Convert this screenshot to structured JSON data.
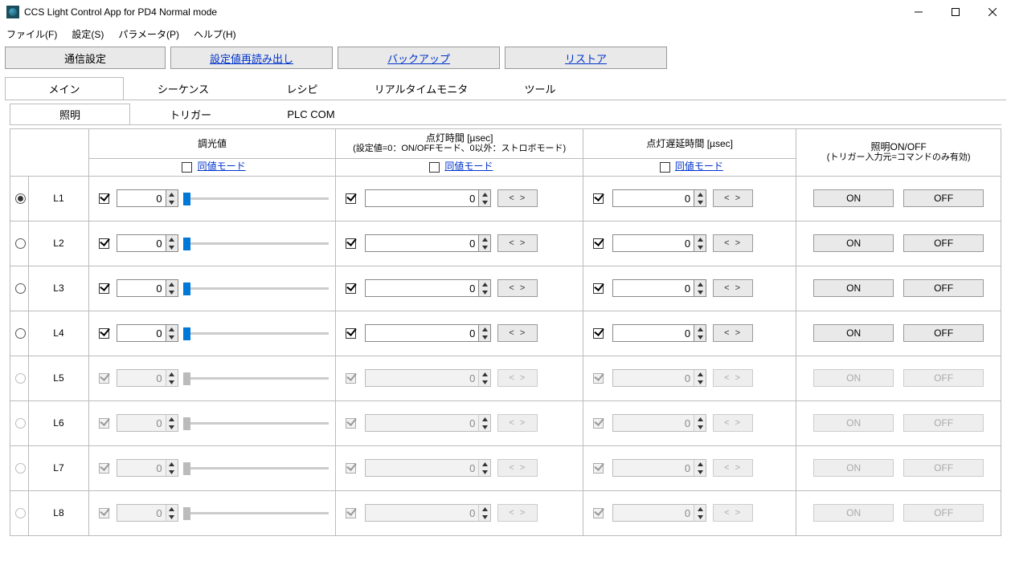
{
  "window": {
    "title": "CCS Light Control App for PD4 Normal mode"
  },
  "menu": {
    "file": "ファイル(F)",
    "settings": "設定(S)",
    "params": "パラメータ(P)",
    "help": "ヘルプ(H)"
  },
  "toolbar": {
    "comm": "通信設定",
    "reread": "設定値再読み出し",
    "backup": "バックアップ",
    "restore": "リストア"
  },
  "tabs": {
    "main": "メイン",
    "sequence": "シーケンス",
    "recipe": "レシピ",
    "realtime": "リアルタイムモニタ",
    "tool": "ツール"
  },
  "subtabs": {
    "light": "照明",
    "trigger": "トリガー",
    "plc": "PLC COM"
  },
  "headers": {
    "dim": "調光値",
    "lightTime": "点灯時間 [µsec]",
    "lightTimeSub": "(設定値=0：ON/OFFモード、0以外：ストロボモード)",
    "delay": "点灯遅延時間 [µsec]",
    "onoff": "照明ON/OFF",
    "onoffSub": "(トリガー入力元=コマンドのみ有効)",
    "sameValue": "同値モード"
  },
  "buttons": {
    "expand": "< >",
    "on": "ON",
    "off": "OFF"
  },
  "rows": [
    {
      "label": "L1",
      "enabled": true,
      "selected": true,
      "dim": 0,
      "lt": 0,
      "delay": 0
    },
    {
      "label": "L2",
      "enabled": true,
      "selected": false,
      "dim": 0,
      "lt": 0,
      "delay": 0
    },
    {
      "label": "L3",
      "enabled": true,
      "selected": false,
      "dim": 0,
      "lt": 0,
      "delay": 0
    },
    {
      "label": "L4",
      "enabled": true,
      "selected": false,
      "dim": 0,
      "lt": 0,
      "delay": 0
    },
    {
      "label": "L5",
      "enabled": false,
      "selected": false,
      "dim": 0,
      "lt": 0,
      "delay": 0
    },
    {
      "label": "L6",
      "enabled": false,
      "selected": false,
      "dim": 0,
      "lt": 0,
      "delay": 0
    },
    {
      "label": "L7",
      "enabled": false,
      "selected": false,
      "dim": 0,
      "lt": 0,
      "delay": 0
    },
    {
      "label": "L8",
      "enabled": false,
      "selected": false,
      "dim": 0,
      "lt": 0,
      "delay": 0
    }
  ]
}
